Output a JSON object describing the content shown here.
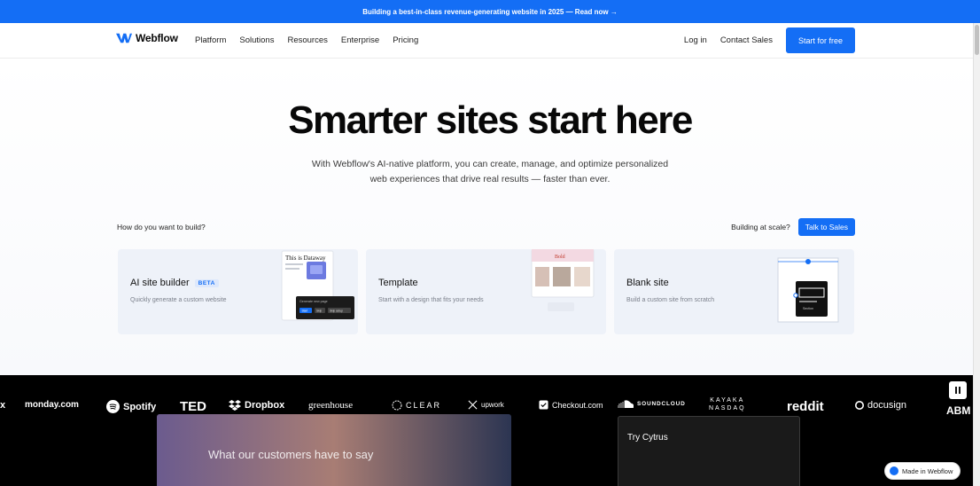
{
  "banner": {
    "text": "Building a best-in-class revenue-generating website in 2025 — Read now →"
  },
  "nav": {
    "brand": "Webflow",
    "links": [
      "Platform",
      "Solutions",
      "Resources",
      "Enterprise",
      "Pricing"
    ],
    "login": "Log in",
    "contact_sales": "Contact Sales",
    "start_free": "Start for free"
  },
  "hero": {
    "title": "Smarter sites start here",
    "subtitle": "With Webflow's AI-native platform, you can create, manage, and optimize personalized web experiences that drive real results — faster than ever."
  },
  "build": {
    "question": "How do you want to build?",
    "scale_question": "Building at scale?",
    "talk_to_sales": "Talk to Sales"
  },
  "cards": [
    {
      "title": "AI site builder",
      "badge": "BETA",
      "description": "Quickly generate a custom website"
    },
    {
      "title": "Template",
      "description": "Start with a design that fits your needs"
    },
    {
      "title": "Blank site",
      "description": "Build a custom site from scratch"
    }
  ],
  "card_art": {
    "ai_heading": "This is Dataway",
    "ai_prompt": "Generate new page",
    "ai_button": "Start",
    "ai_button2": "Skip",
    "ai_button3": "Skip setup",
    "template_label": "Bold",
    "blank_label": "Section"
  },
  "logos": [
    "x",
    "monday.com",
    "Spotify",
    "TED",
    "Dropbox",
    "greenhouse",
    "CLEAR",
    "upwork",
    "Checkout.com",
    "SOUNDCLOUD",
    "NASDAQ",
    "reddit",
    "docusign",
    "ABM"
  ],
  "logo_extra": "KAYAKA",
  "showcase": {
    "video_text": "What our customers have to say",
    "panel_title": "Try Cytrus"
  },
  "badge_made_in": "Made in Webflow",
  "colors": {
    "brand_blue": "#146ef5",
    "dark": "#080808"
  }
}
